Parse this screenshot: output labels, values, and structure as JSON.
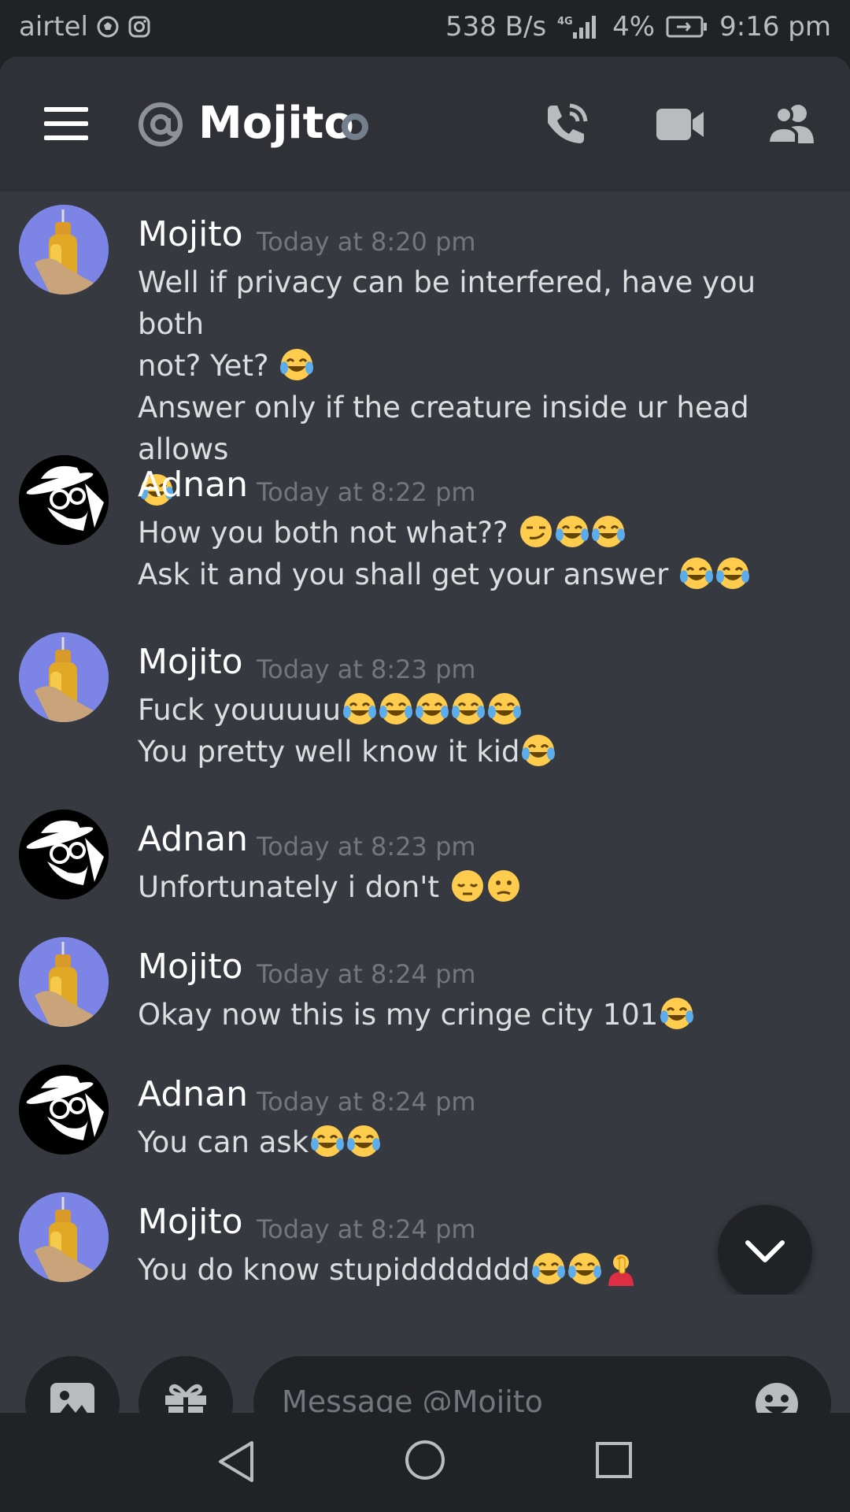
{
  "status_bar": {
    "carrier": "airtel",
    "speed": "538 B/s",
    "network": "4G",
    "battery": "4%",
    "time": "9:16 pm"
  },
  "header": {
    "title": "Mojito",
    "icons": [
      "menu-icon",
      "at-icon",
      "status-offline-icon",
      "call-icon",
      "video-icon",
      "members-icon"
    ]
  },
  "messages": [
    {
      "author": "Mojito",
      "avatar": "mojito",
      "time": "Today at 8:20 pm",
      "lines": [
        {
          "text": "Well if privacy can be interfered, have you both",
          "emoji": []
        },
        {
          "text": "not? Yet? ",
          "emoji": [
            "joy"
          ]
        },
        {
          "text": "Answer only if the creature inside ur head allows",
          "emoji": []
        },
        {
          "text": "",
          "emoji": [
            "joy"
          ]
        }
      ]
    },
    {
      "author": "Adnan",
      "avatar": "adnan",
      "time": "Today at 8:22 pm",
      "lines": [
        {
          "text": "How you both not what?? ",
          "emoji": [
            "smirk",
            "joy",
            "joy"
          ]
        },
        {
          "text": "Ask it and you shall get your answer ",
          "emoji": [
            "joy",
            "joy"
          ]
        }
      ]
    },
    {
      "author": "Mojito",
      "avatar": "mojito",
      "time": "Today at 8:23 pm",
      "lines": [
        {
          "text": "Fuck youuuuu",
          "emoji": [
            "joy",
            "joy",
            "joy",
            "joy",
            "joy"
          ]
        },
        {
          "text": "You pretty well know it kid",
          "emoji": [
            "joy"
          ]
        }
      ]
    },
    {
      "author": "Adnan",
      "avatar": "adnan",
      "time": "Today at 8:23 pm",
      "lines": [
        {
          "text": "Unfortunately i don't ",
          "emoji": [
            "pensive",
            "confused"
          ]
        }
      ]
    },
    {
      "author": "Mojito",
      "avatar": "mojito",
      "time": "Today at 8:24 pm",
      "lines": [
        {
          "text": "Okay now this is my cringe city 101",
          "emoji": [
            "joy"
          ]
        }
      ]
    },
    {
      "author": "Adnan",
      "avatar": "adnan",
      "time": "Today at 8:24 pm",
      "lines": [
        {
          "text": "You can ask",
          "emoji": [
            "joy",
            "joy"
          ]
        }
      ]
    },
    {
      "author": "Mojito",
      "avatar": "mojito",
      "time": "Today at 8:24 pm",
      "lines": [
        {
          "text": "You do know stupiddddddd",
          "emoji": [
            "joy",
            "joy",
            "facepalm"
          ]
        }
      ]
    }
  ],
  "composer": {
    "placeholder": "Message @Mojito",
    "buttons": [
      "image-icon",
      "gift-icon",
      "emoji-icon"
    ]
  },
  "nav_bar": {
    "buttons": [
      "back-icon",
      "home-icon",
      "recents-icon"
    ]
  },
  "colors": {
    "background": "#36393f",
    "header": "#2f3136",
    "dark": "#202225",
    "text": "#dcddde",
    "muted": "#72767d",
    "mojito_avatar": "#7c85e6"
  }
}
